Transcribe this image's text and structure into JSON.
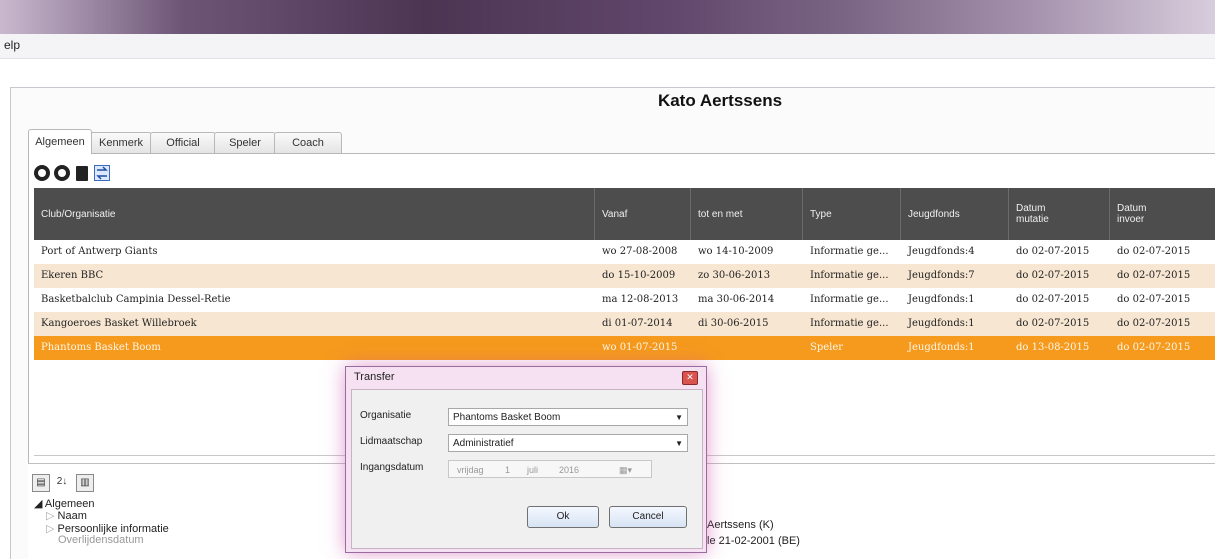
{
  "menubar": {
    "help_label": "elp"
  },
  "page": {
    "title": "Kato Aertssens"
  },
  "tabs": [
    {
      "label": "Algemeen"
    },
    {
      "label": "Kenmerk"
    },
    {
      "label": "Official"
    },
    {
      "label": "Speler"
    },
    {
      "label": "Coach"
    }
  ],
  "toolbar": {
    "icons": [
      "add-icon",
      "remove-icon",
      "document-icon",
      "transfer-icon"
    ]
  },
  "grid": {
    "columns": [
      "Club/Organisatie",
      "Vanaf",
      "tot en met",
      "Type",
      "Jeugdfonds",
      "Datum mutatie",
      "Datum invoer"
    ],
    "rows": [
      {
        "club": "Port of Antwerp Giants",
        "vanaf": "wo 27-08-2008",
        "tot": "wo 14-10-2009",
        "type": "Informatie ge...",
        "jeugdfonds": "Jeugdfonds:4",
        "mutatie": "do 02-07-2015",
        "invoer": "do 02-07-2015"
      },
      {
        "club": "Ekeren BBC",
        "vanaf": "do 15-10-2009",
        "tot": "zo 30-06-2013",
        "type": "Informatie ge...",
        "jeugdfonds": "Jeugdfonds:7",
        "mutatie": "do 02-07-2015",
        "invoer": "do 02-07-2015"
      },
      {
        "club": "Basketbalclub Campinia Dessel-Retie",
        "vanaf": "ma 12-08-2013",
        "tot": "ma 30-06-2014",
        "type": "Informatie ge...",
        "jeugdfonds": "Jeugdfonds:1",
        "mutatie": "do 02-07-2015",
        "invoer": "do 02-07-2015"
      },
      {
        "club": "Kangoeroes Basket Willebroek",
        "vanaf": "di 01-07-2014",
        "tot": "di 30-06-2015",
        "type": "Informatie ge...",
        "jeugdfonds": "Jeugdfonds:1",
        "mutatie": "do 02-07-2015",
        "invoer": "do 02-07-2015"
      },
      {
        "club": "Phantoms Basket Boom",
        "vanaf": "wo 01-07-2015",
        "tot": "",
        "type": "Speler",
        "jeugdfonds": "Jeugdfonds:1",
        "mutatie": "do 13-08-2015",
        "invoer": "do 02-07-2015"
      }
    ],
    "colors": {
      "header": "#4d4d4d",
      "row_even": "#ffffff",
      "row_odd": "#f7e6d2",
      "row_selected": "#f59a1d"
    }
  },
  "property_toolbar": {
    "sort_label": "2↓"
  },
  "properties": {
    "category": "Algemeen",
    "items": [
      "Naam",
      "Persoonlijke informatie",
      "Overlijdensdatum"
    ],
    "values": [
      "Aertssens (K)",
      "le 21-02-2001  (BE)"
    ]
  },
  "dialog": {
    "title": "Transfer",
    "organisatie_label": "Organisatie",
    "organisatie_value": "Phantoms Basket Boom",
    "lidmaatschap_label": "Lidmaatschap",
    "lidmaatschap_value": "Administratief",
    "ingangsdatum_label": "Ingangsdatum",
    "date_day": "vrijdag",
    "date_num": "1",
    "date_month": "juli",
    "date_year": "2016",
    "ok_label": "Ok",
    "cancel_label": "Cancel"
  }
}
